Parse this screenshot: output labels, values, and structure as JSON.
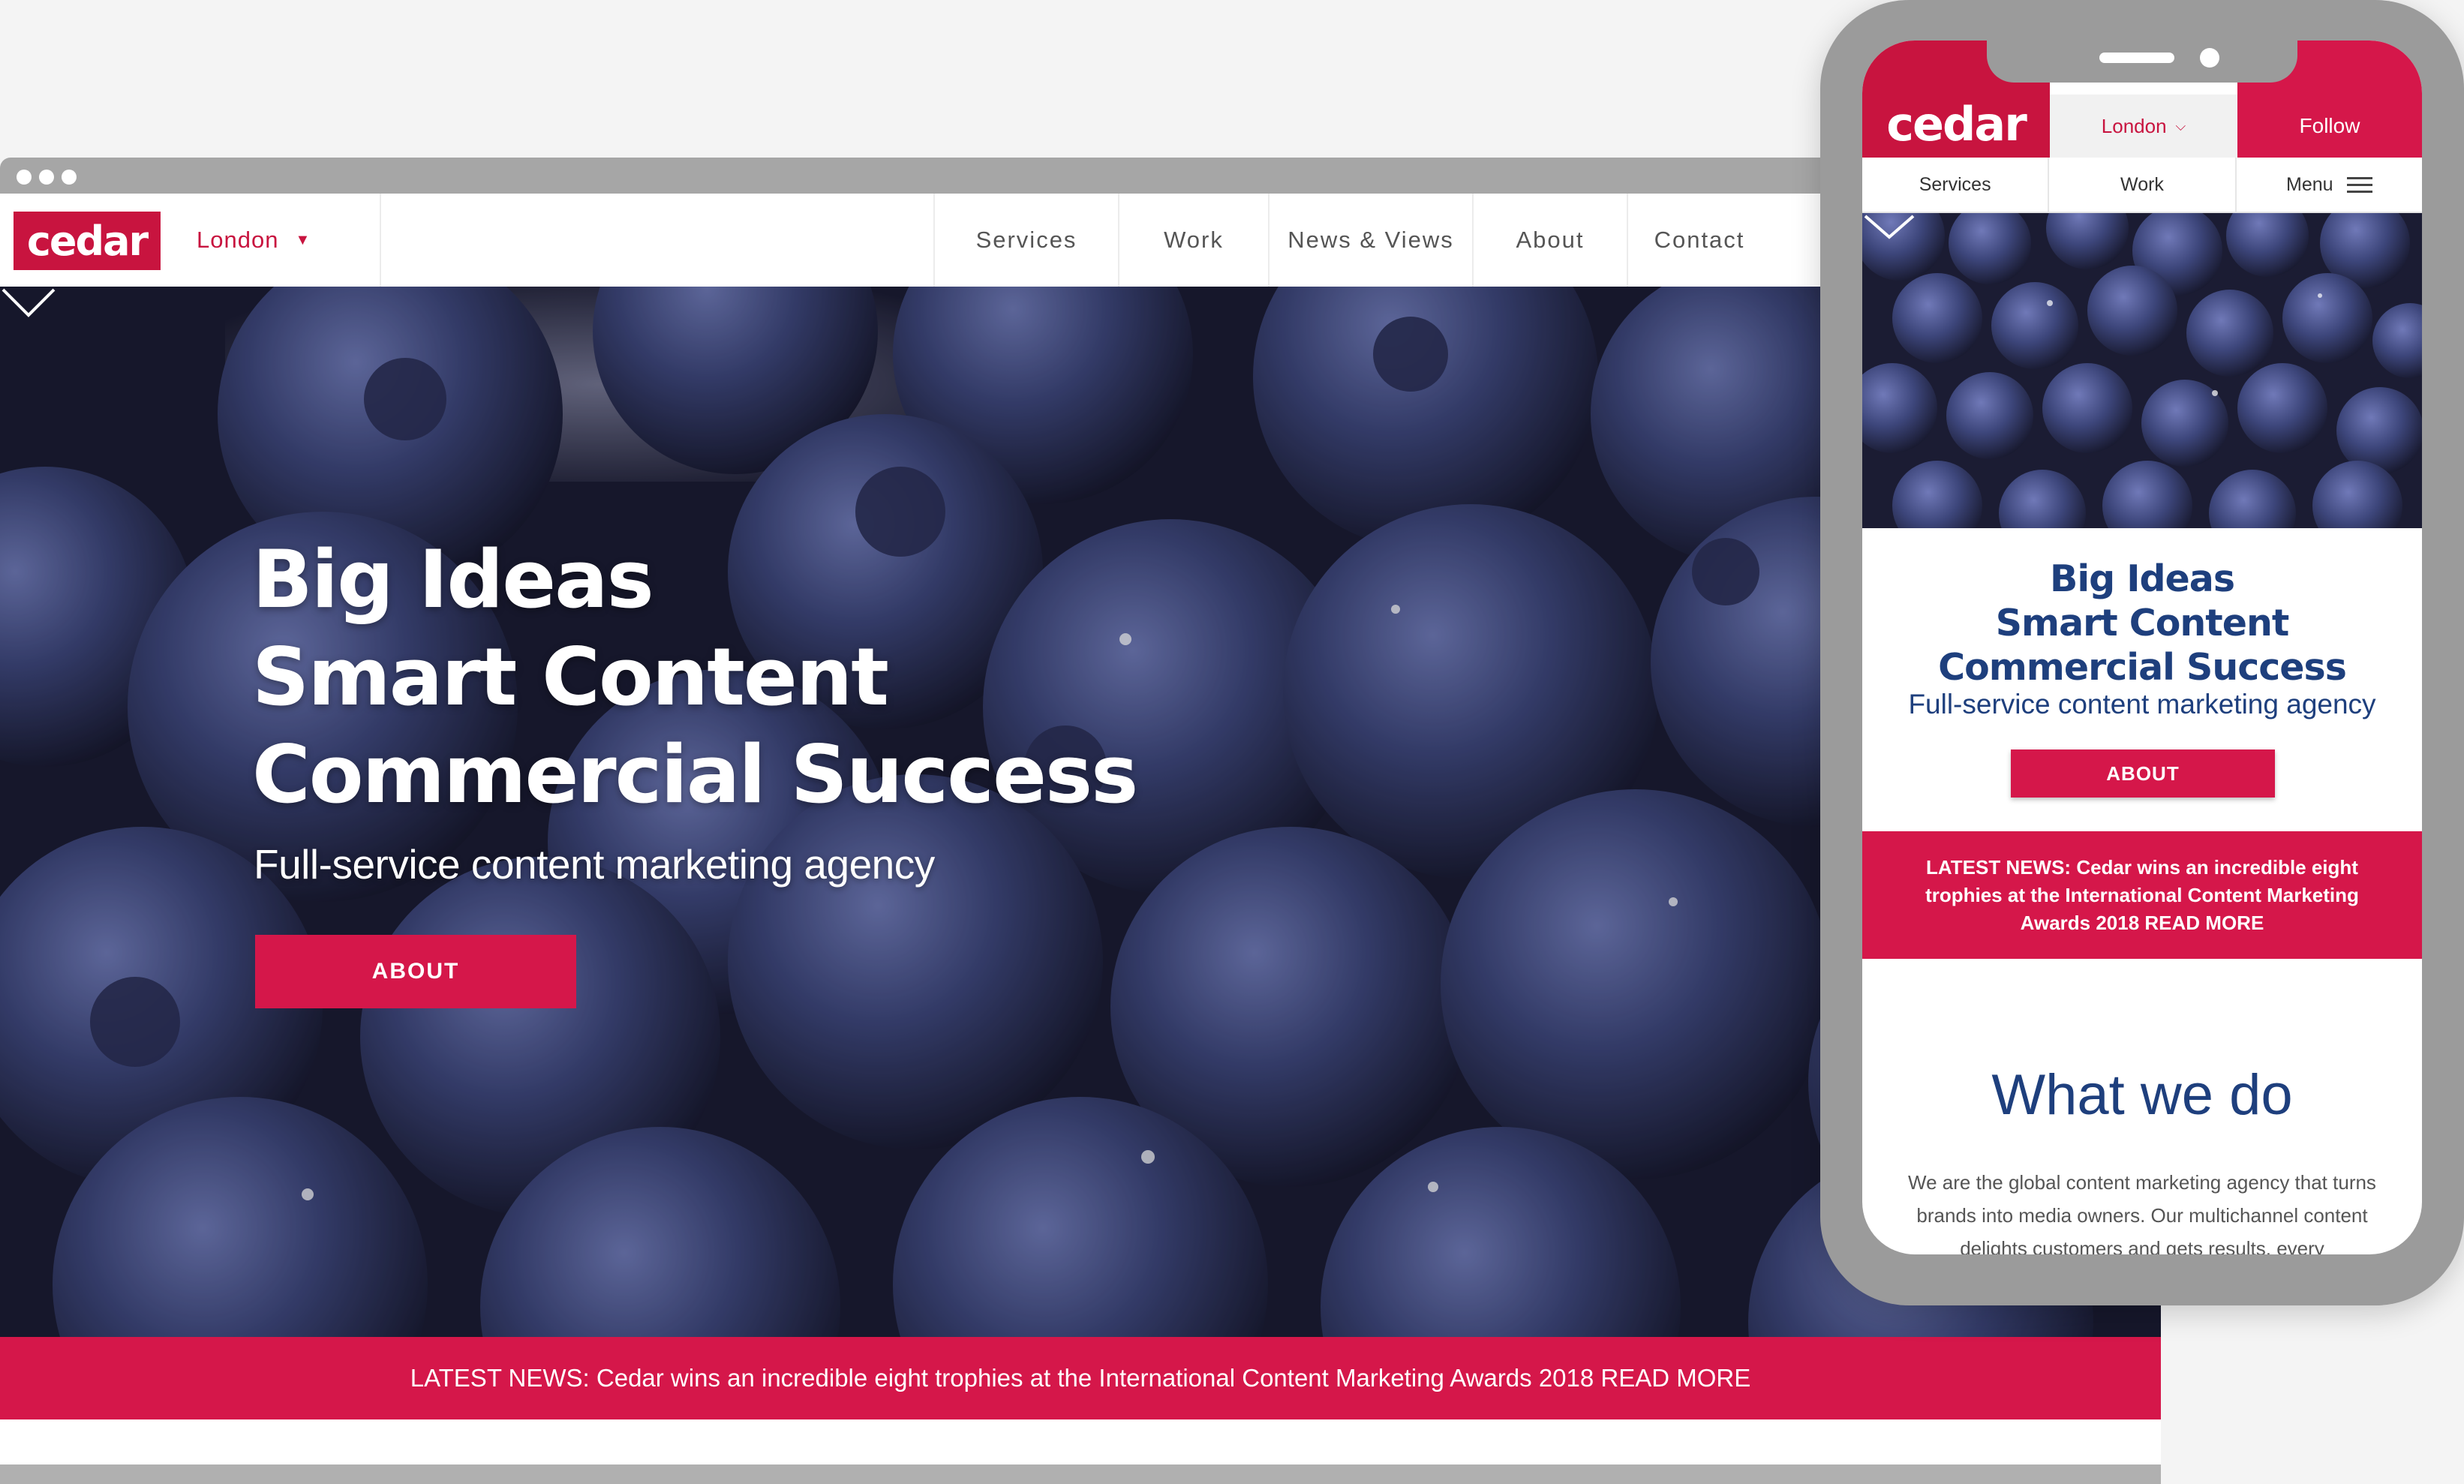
{
  "colors": {
    "brand_red": "#c8143f",
    "accent_pink": "#d5174a",
    "navy": "#1e3f7d",
    "background": "#f4f4f4"
  },
  "desktop": {
    "logo": "cedar",
    "city": "London",
    "nav": [
      "Services",
      "Work",
      "News & Views",
      "About",
      "Contact"
    ],
    "hero": {
      "title_lines": [
        "Big Ideas",
        "Smart Content",
        "Commercial Success"
      ],
      "subtitle": "Full-service content marketing agency",
      "button": "ABOUT"
    },
    "news": "LATEST NEWS: Cedar wins an incredible eight trophies at the International Content Marketing Awards 2018 READ MORE"
  },
  "mobile": {
    "logo": "cedar",
    "city": "London",
    "follow": "Follow",
    "nav": [
      "Services",
      "Work",
      "Menu"
    ],
    "hero": {
      "title_lines": [
        "Big Ideas",
        "Smart Content",
        "Commercial Success"
      ],
      "subtitle": "Full-service content marketing agency",
      "button": "ABOUT"
    },
    "news": "LATEST NEWS: Cedar wins an incredible eight trophies at the International Content Marketing Awards 2018 READ MORE",
    "what_we_do": {
      "title": "What we do",
      "body": "We are the global content marketing agency that turns brands into media owners. Our multichannel content delights customers and gets results, every"
    }
  },
  "icons": {
    "city_dropdown": "chevron-down-icon",
    "scroll_down": "chevron-down-icon",
    "menu": "hamburger-menu-icon"
  }
}
